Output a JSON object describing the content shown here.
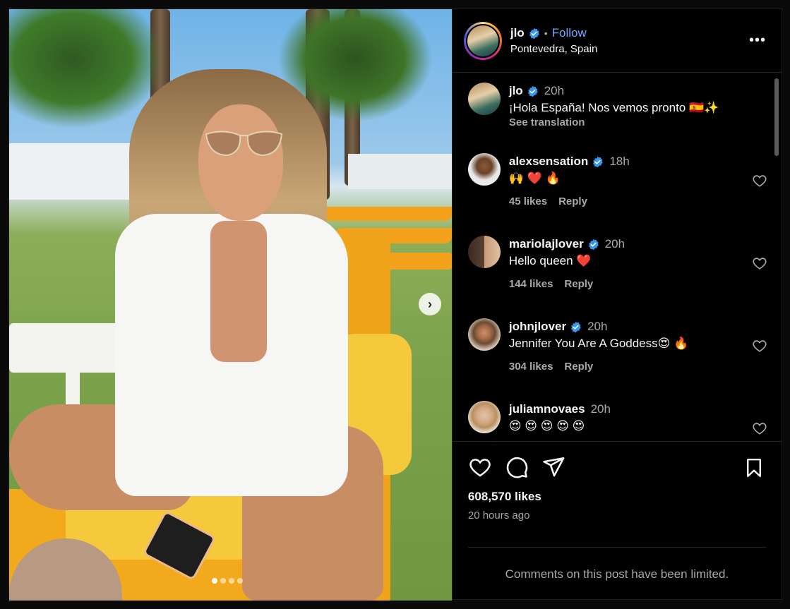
{
  "post": {
    "author": "jlo",
    "follow_label": "Follow",
    "separator": "•",
    "location": "Pontevedra, Spain",
    "more_label": "•••",
    "caption": {
      "username": "jlo",
      "time": "20h",
      "text": "¡Hola España! Nos vemos pronto 🇪🇸✨",
      "see_translation": "See translation"
    }
  },
  "comments": [
    {
      "username": "alexsensation",
      "time": "18h",
      "text": "🙌 ❤️ 🔥",
      "likes": "45 likes",
      "reply": "Reply"
    },
    {
      "username": "mariolajlover",
      "time": "20h",
      "text": "Hello queen ❤️",
      "likes": "144 likes",
      "reply": "Reply"
    },
    {
      "username": "johnjlover",
      "time": "20h",
      "text": "Jennifer You Are A Goddess😍 🔥",
      "likes": "304 likes",
      "reply": "Reply"
    },
    {
      "username": "juliamnovaes",
      "time": "20h",
      "text": "😍 😍 😍 😍 😍"
    }
  ],
  "footer": {
    "likes": "608,570 likes",
    "posted": "20 hours ago",
    "limited_notice": "Comments on this post have been limited."
  },
  "carousel": {
    "current": 1,
    "total": 4
  },
  "colors": {
    "accent": "#6ea8fe",
    "background": "#000000",
    "muted": "#a8a8a8",
    "verified": "#3897f0"
  }
}
